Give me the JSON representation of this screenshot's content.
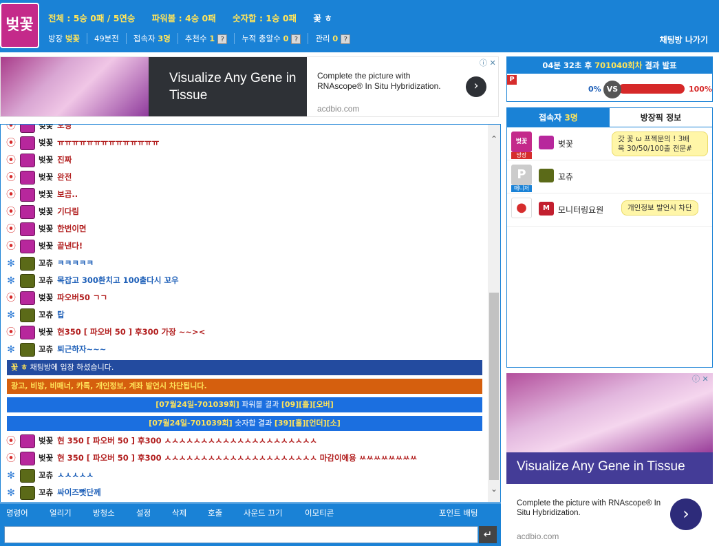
{
  "header": {
    "logo_text": "벚꽃",
    "stats": {
      "total": "전체 : 5승 0패 / 5연승",
      "power": "파워볼 : 4승 0패",
      "number": "숫자합 : 1승 0패",
      "room_title": "꽃 ㅎ"
    },
    "info": {
      "owner_label": "방장",
      "owner_name": "벚꽃",
      "elapsed": "49분전",
      "visitors_label": "접속자",
      "visitors_value": "3명",
      "recommend_label": "추천수",
      "recommend_value": "1",
      "hits_label": "누적 총알수",
      "hits_value": "0",
      "manage_label": "관리",
      "manage_value": "0",
      "help_glyph": "?"
    },
    "leave_label": "채팅방 나가기"
  },
  "ad_top": {
    "headline": "Visualize Any Gene in Tissue",
    "body": "Complete the picture with RNAscope® In Situ Hybridization.",
    "url": "acdbio.com",
    "arrow": "›",
    "adchoice": "ⓘ ✕"
  },
  "chat": {
    "messages": [
      {
        "user": "벚꽃",
        "text": "오빵",
        "side": "pink"
      },
      {
        "user": "벚꽃",
        "text": "ㅠㅠㅠㅠㅠㅠㅠㅠㅠㅠㅠㅠㅠㅠ",
        "side": "pink"
      },
      {
        "user": "벚꽃",
        "text": "진짜",
        "side": "pink"
      },
      {
        "user": "벚꽃",
        "text": "완전",
        "side": "pink"
      },
      {
        "user": "벚꽃",
        "text": "보곱..",
        "side": "pink"
      },
      {
        "user": "벚꽃",
        "text": "기다림",
        "side": "pink"
      },
      {
        "user": "벚꽃",
        "text": "한번이면",
        "side": "pink"
      },
      {
        "user": "벚꽃",
        "text": "끝낸다!",
        "side": "pink"
      },
      {
        "user": "꼬츄",
        "text": "ㅋㅋㅋㅋㅋ",
        "side": "green"
      },
      {
        "user": "꼬츄",
        "text": "목잡고 300환치고 100출다시 꼬우",
        "side": "green"
      },
      {
        "user": "벚꽃",
        "text": "파오버50 ㄱㄱ",
        "side": "pink"
      },
      {
        "user": "꼬츄",
        "text": "탑",
        "side": "green"
      },
      {
        "user": "벚꽃",
        "text": "현350 [ 파오버 50 ] 후300 가장 ~~><",
        "side": "pink"
      },
      {
        "user": "꼬츄",
        "text": "퇴근하자~~~",
        "side": "green"
      }
    ],
    "notice_enter_name": "꽃 ㅎ",
    "notice_enter_text": "채팅방에 입장 하셨습니다.",
    "notice_ban": "광고, 비방, 비매너, 카톡, 개인정보, 계좌 발언시 차단됩니다.",
    "result1_pre": "[07월24일-701039회]",
    "result1_mid": "파워볼 결과",
    "result1_val": "[09][홀][오버]",
    "result2_pre": "[07월24일-701039회]",
    "result2_mid": "숫자합 결과",
    "result2_val": "[39][홀][언더][소]",
    "messages2": [
      {
        "user": "벚꽃",
        "text": "현 350 [ 파오버 50 ] 후300 ㅅㅅㅅㅅㅅㅅㅅㅅㅅㅅㅅㅅㅅㅅㅅㅅㅅㅅㅅㅅㅅ",
        "side": "pink"
      },
      {
        "user": "벚꽃",
        "text": "현 350 [ 파오버 50 ] 후300 ㅅㅅㅅㅅㅅㅅㅅㅅㅅㅅㅅㅅㅅㅅㅅㅅㅅㅅㅅㅅㅅ 마감이에용 ㅆㅆㅆㅆㅆㅆㅆㅆ",
        "side": "pink"
      },
      {
        "user": "꼬츄",
        "text": "ㅅㅅㅅㅅㅅ",
        "side": "green"
      },
      {
        "user": "꼬츄",
        "text": "싸이즈뻣단께",
        "side": "green"
      }
    ]
  },
  "toolbar": {
    "items": [
      "명령어",
      "얼리기",
      "방청소",
      "설정",
      "삭제",
      "호출",
      "사운드 끄기",
      "이모티콘"
    ],
    "point_bet": "포인트 배팅",
    "send_glyph": "↵"
  },
  "result_panel": {
    "timer": "04분 32초 후",
    "round": "701040회차",
    "announce": "결과 발표",
    "p_badge": "P",
    "left_pct": "0%",
    "vs": "VS",
    "right_pct": "100%"
  },
  "users_panel": {
    "tab_users_label": "접속자",
    "tab_users_count": "3명",
    "tab_info": "방장픽 정보",
    "users": [
      {
        "name": "벚꽃",
        "role": "방장",
        "bubble": "갓 꽃 ω 프젝문의 ! 3배\n목 30/50/100출 전문#"
      },
      {
        "name": "꼬츄",
        "role": "매니저",
        "bubble": ""
      },
      {
        "name": "모니터링요원",
        "role": "",
        "bubble": "개인정보 발언시 차단"
      }
    ]
  },
  "ad_right": {
    "headline": "Visualize Any Gene in Tissue",
    "body": "Complete the picture with RNAscope® In Situ Hybridization.",
    "url": "acdbio.com",
    "arrow": "›",
    "adchoice": "ⓘ ✕"
  },
  "colors": {
    "primary": "#1a82d6",
    "highlight": "#ffe45a",
    "red": "#d62d2d"
  }
}
